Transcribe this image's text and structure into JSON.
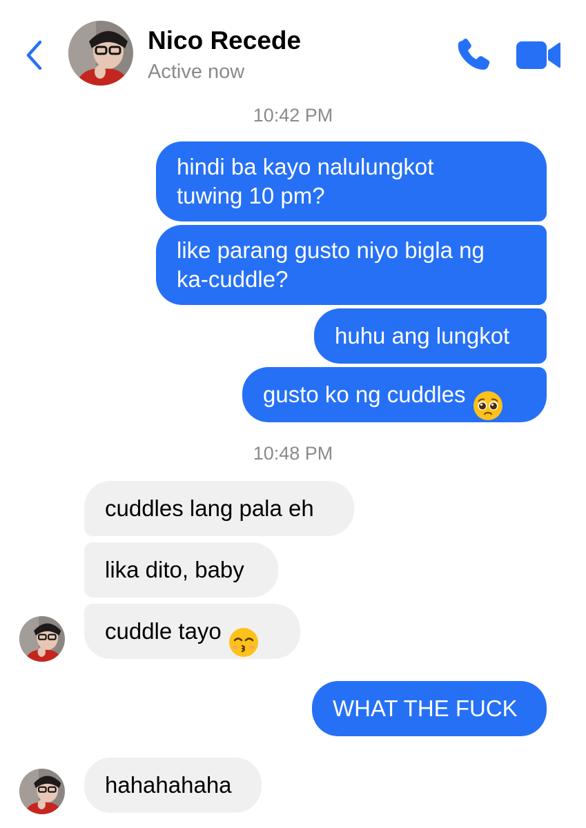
{
  "header": {
    "contact_name": "Nico Recede",
    "status": "Active now",
    "back_icon": "chevron-left-icon",
    "call_icon": "phone-icon",
    "video_icon": "video-camera-icon",
    "accent_color": "#2670f6"
  },
  "conversation": {
    "timestamp_1": "10:42 PM",
    "timestamp_2": "10:48 PM",
    "messages": [
      {
        "sender": "me",
        "text": "hindi ba kayo nalulungkot\ntuwing 10 pm?"
      },
      {
        "sender": "me",
        "text": "like parang gusto niyo bigla ng\nka-cuddle?"
      },
      {
        "sender": "me",
        "text": "huhu ang lungkot"
      },
      {
        "sender": "me",
        "text": "gusto ko ng cuddles",
        "emoji": "pleading-face-emoji"
      },
      {
        "sender": "contact",
        "text": "cuddles lang pala eh"
      },
      {
        "sender": "contact",
        "text": "lika dito, baby"
      },
      {
        "sender": "contact",
        "text": "cuddle tayo",
        "emoji": "kissing-face-emoji"
      },
      {
        "sender": "me",
        "text": "WHAT THE FUCK"
      },
      {
        "sender": "contact",
        "text": "hahahahaha"
      }
    ]
  },
  "colors": {
    "outgoing_bubble": "#2670f6",
    "incoming_bubble": "#f0f0f0",
    "muted_text": "#8a8a8e"
  }
}
